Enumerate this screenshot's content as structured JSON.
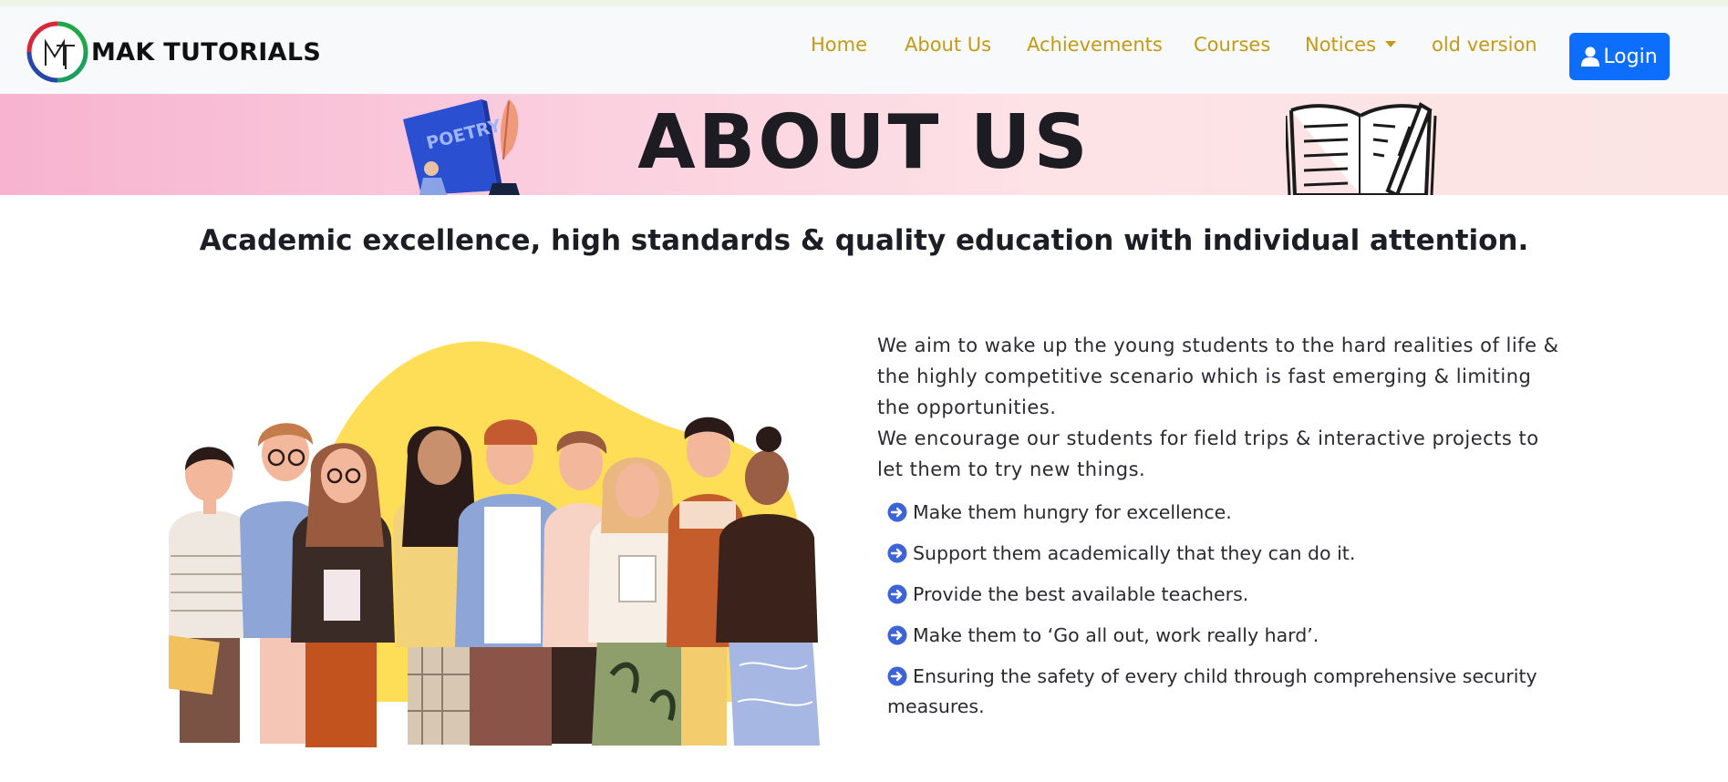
{
  "brand": {
    "logo_text": "MT",
    "name": "MAK TUTORIALS"
  },
  "nav": {
    "items": [
      {
        "label": "Home"
      },
      {
        "label": "About Us"
      },
      {
        "label": "Achievements"
      },
      {
        "label": "Courses"
      },
      {
        "label": "Notices",
        "has_dropdown": true
      },
      {
        "label": "old version"
      }
    ],
    "login_label": "Login",
    "link_color": "#c49a14",
    "login_color": "#0d6efd"
  },
  "banner": {
    "title": "ABOUT US",
    "book_label": "POETRY"
  },
  "tagline": "Academic excellence, high standards & quality education with individual attention.",
  "about": {
    "paragraph1": "We aim to wake up the young students to the hard realities of life & the highly competitive scenario which is fast emerging & limiting the opportunities.",
    "paragraph2": "We encourage our students for field trips & interactive projects to let them to try new things.",
    "bullets": [
      "Make them hungry for excellence.",
      "Support them academically that they can do it.",
      "Provide the best available teachers.",
      "Make them to ‘Go all out, work really hard’.",
      "Ensuring the safety of every child through comprehensive security measures."
    ],
    "bullet_icon": "arrow-right-circle-icon"
  }
}
